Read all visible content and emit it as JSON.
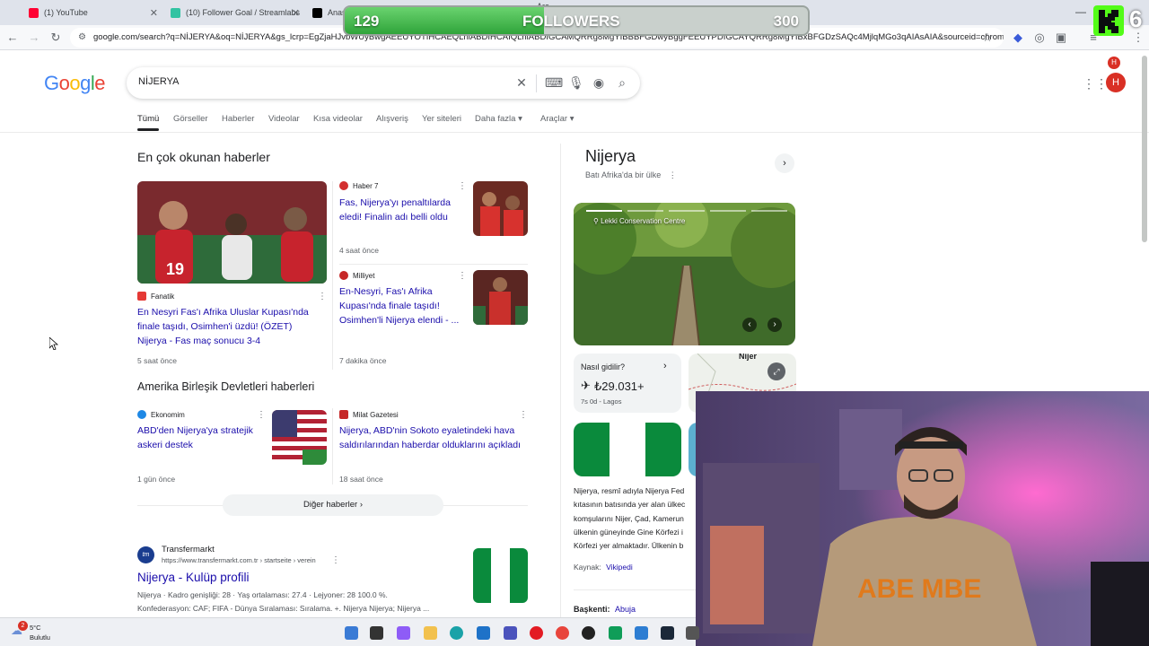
{
  "browser": {
    "tabs": [
      {
        "title": "(1) YouTube",
        "color": "#ff0033"
      },
      {
        "title": "(10) Follower Goal / Streamlabs",
        "color": "#31c3a2"
      },
      {
        "title": "Anas",
        "color": "#000000"
      },
      {
        "title": "Ara",
        "color": "#4285f4"
      }
    ],
    "url": "google.com/search?q=NİJERYA&oq=NİJERYA&gs_lcrp=EgZjaHJvbWUyBwgAEEUYOTIHCAEQLhiABDIHCAIQLhiABDIGCAMQRRg8MgYIBBBFGDwyBggFEEUYPDIGCAYQRRg8MgYIBxBFGDzSAQc4MjlqMGo3qAIAsAIA&sourceid=chrome&ie=UTF-8"
  },
  "followers_goal": {
    "current": "129",
    "label": "FOLLOWERS",
    "target": "300",
    "progress": 0.43
  },
  "kick_badge": "6",
  "search": {
    "logo": "Google",
    "query": "NİJERYA",
    "avatar_letter": "H",
    "nav": [
      "Tümü",
      "Görseller",
      "Haberler",
      "Videolar",
      "Kısa videolar",
      "Alışveriş",
      "Yer siteleri",
      "Daha fazla",
      "Araçlar"
    ]
  },
  "top_news": {
    "title": "En çok okunan haberler",
    "cards": [
      {
        "source": "Fanatik",
        "headline_lines": [
          "En Nesyri Fas'ı Afrika Uluslar Kupası'nda",
          "finale taşıdı, Osimhen'i üzdü! (ÖZET)",
          "Nijerya - Fas maç sonucu 3-4"
        ],
        "time": "5 saat önce",
        "source_color": "#e53935"
      },
      {
        "source": "Haber 7",
        "headline_lines": [
          "Fas, Nijerya'yı penaltılarda",
          "eledi! Finalin adı belli oldu"
        ],
        "time": "4 saat önce",
        "source_color": "#d32f2f"
      },
      {
        "source": "Milliyet",
        "headline_lines": [
          "En-Nesyri, Fas'ı Afrika",
          "Kupası'nda finale taşıdı!",
          "Osimhen'li Nijerya elendi - ..."
        ],
        "time": "7 dakika önce",
        "source_color": "#c62828"
      }
    ]
  },
  "us_news": {
    "title": "Amerika Birleşik Devletleri haberleri",
    "cards": [
      {
        "source": "Ekonomim",
        "headline_lines": [
          "ABD'den Nijerya'ya stratejik",
          "askeri destek"
        ],
        "time": "1 gün önce",
        "source_color": "#1e88e5"
      },
      {
        "source": "Milat Gazetesi",
        "headline_lines": [
          "Nijerya, ABD'nin Sokoto eyaletindeki hava",
          "saldırılarından haberdar olduklarını açıkladı"
        ],
        "time": "18 saat önce",
        "source_color": "#c62828"
      }
    ],
    "more_label": "Diğer haberler"
  },
  "result": {
    "site_name": "Transfermarkt",
    "site_url": "https://www.transfermarkt.com.tr › startseite › verein",
    "title": "Nijerya - Kulüp profili",
    "snippet_lines": [
      "Nijerya · Kadro genişliği: 28 · Yaş ortalaması: 27.4 · Lejyoner: 28 100.0 %.",
      "Konfederasyon: CAF; FIFA - Dünya Sıralaması: Sıralama. +. Nijerya Nijerya; Nijerya ..."
    ]
  },
  "knowledge_panel": {
    "title": "Nijerya",
    "subtitle": "Batı Afrika'da bir ülke",
    "photo_label": "Lekki Conservation Centre",
    "travel_label": "Nasıl gidilir?",
    "price": "₺29.031+",
    "travel_detail": "7s 0d - Lagos",
    "map_label": "Nijer",
    "description_lines": [
      "Nijerya, resmî adıyla Nijerya Fed",
      "kıtasının batısında yer alan ülkec",
      "komşularını Nijer, Çad, Kamerun",
      "ülkenin güneyinde Gine Körfezi i",
      "Körfezi yer almaktadır. Ülkenin b"
    ],
    "source_label": "Kaynak:",
    "source_link": "Vikipedi",
    "capital_label": "Başkenti:",
    "capital_value": "Abuja"
  },
  "taskbar": {
    "weather_temp": "5°C",
    "weather_text": "Bulutlu",
    "badge": "2"
  }
}
